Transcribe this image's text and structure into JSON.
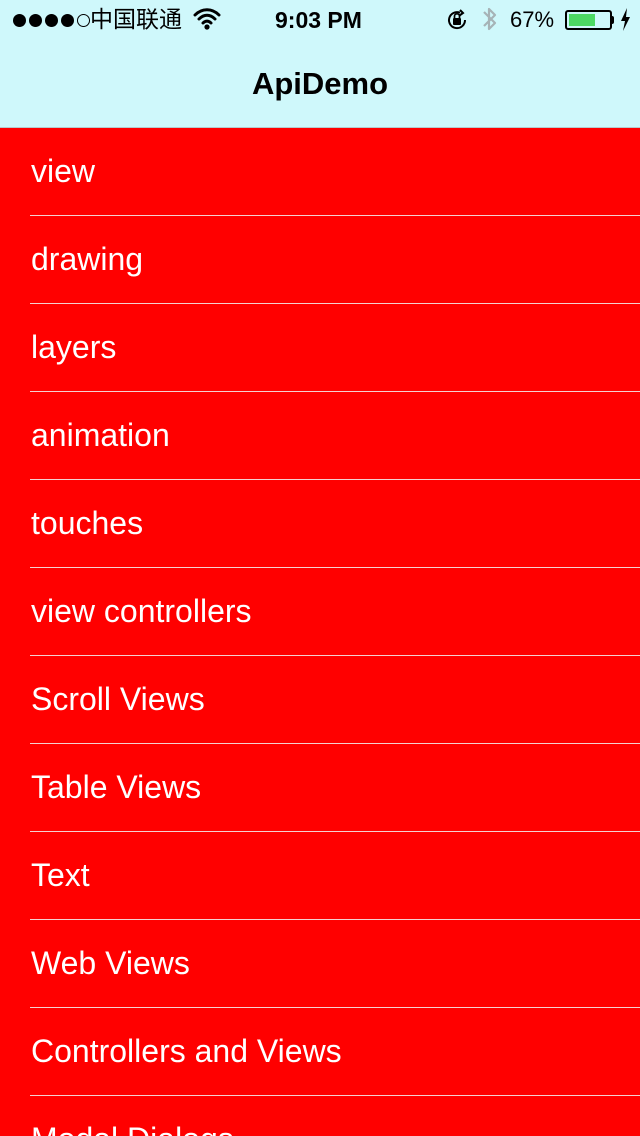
{
  "status_bar": {
    "carrier": "中国联通",
    "time": "9:03 PM",
    "battery_percent": "67%",
    "battery_level": 0.67,
    "icons": {
      "signal": "signal-dots-icon",
      "wifi": "wifi-icon",
      "rotation_lock": "rotation-lock-icon",
      "bluetooth": "bluetooth-icon",
      "battery": "battery-icon",
      "charging": "charging-bolt-icon"
    }
  },
  "navigation": {
    "title": "ApiDemo"
  },
  "colors": {
    "nav_background": "#cff8fb",
    "table_background": "#ff0000",
    "cell_text": "#ffffff",
    "battery_fill": "#4cd964"
  },
  "menu": {
    "items": [
      {
        "label": "view"
      },
      {
        "label": "drawing"
      },
      {
        "label": "layers"
      },
      {
        "label": "animation"
      },
      {
        "label": "touches"
      },
      {
        "label": "view controllers"
      },
      {
        "label": "Scroll Views"
      },
      {
        "label": "Table Views"
      },
      {
        "label": "Text"
      },
      {
        "label": "Web Views"
      },
      {
        "label": "Controllers and Views"
      },
      {
        "label": "Modal Dialogs"
      }
    ]
  }
}
